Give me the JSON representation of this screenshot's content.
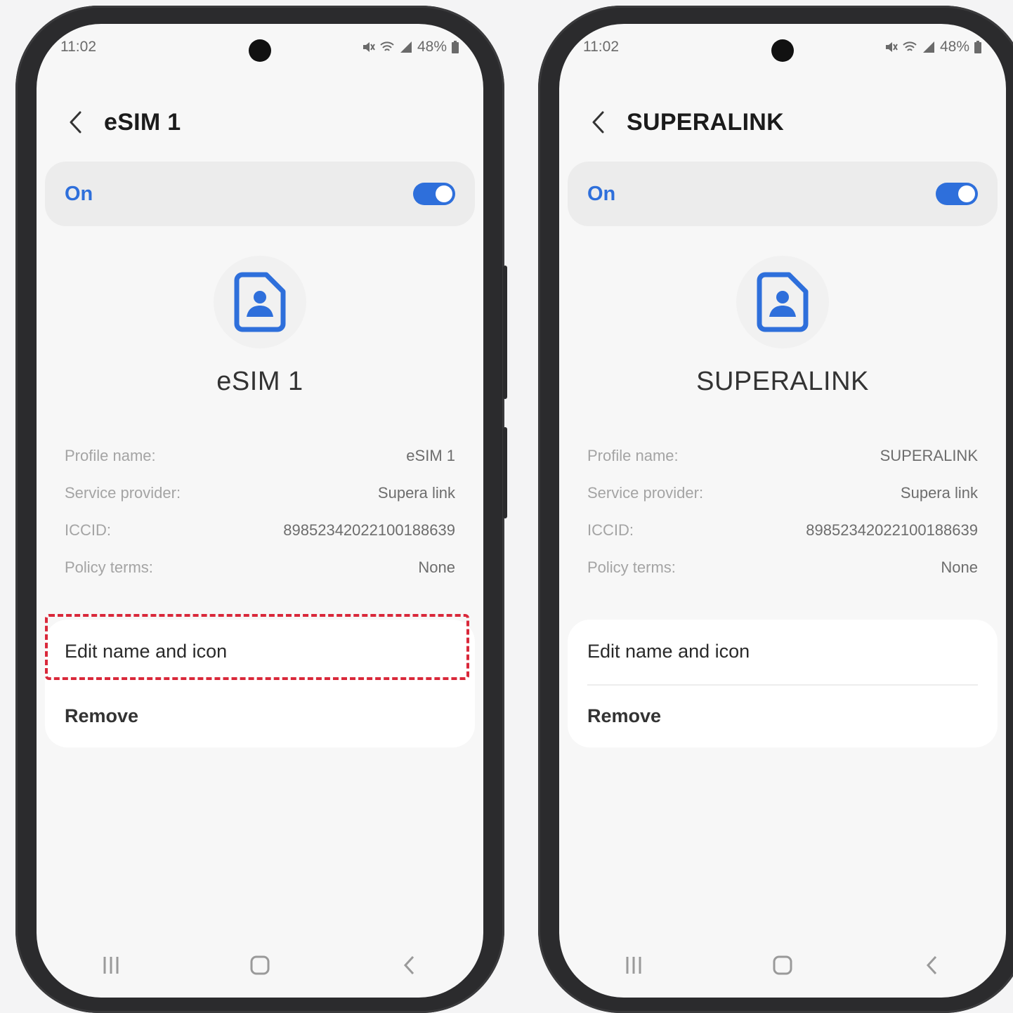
{
  "phones": [
    {
      "status": {
        "time": "11:02",
        "battery": "48%"
      },
      "title": "eSIM 1",
      "toggle_label": "On",
      "toggle_on": true,
      "profile_display_name": "eSIM 1",
      "details": [
        {
          "key": "Profile name:",
          "value": "eSIM 1"
        },
        {
          "key": "Service provider:",
          "value": "Supera link"
        },
        {
          "key": "ICCID:",
          "value": "89852342022100188639"
        },
        {
          "key": "Policy terms:",
          "value": "None"
        }
      ],
      "actions": {
        "edit": "Edit name and icon",
        "remove": "Remove"
      },
      "highlight_color": "#d9283a"
    },
    {
      "status": {
        "time": "11:02",
        "battery": "48%"
      },
      "title": "SUPERALINK",
      "toggle_label": "On",
      "toggle_on": true,
      "profile_display_name": "SUPERALINK",
      "details": [
        {
          "key": "Profile name:",
          "value": "SUPERALINK"
        },
        {
          "key": "Service provider:",
          "value": "Supera link"
        },
        {
          "key": "ICCID:",
          "value": "89852342022100188639"
        },
        {
          "key": "Policy terms:",
          "value": "None"
        }
      ],
      "actions": {
        "edit": "Edit name and icon",
        "remove": "Remove"
      }
    }
  ],
  "colors": {
    "accent": "#2e6fdb",
    "background": "#f7f7f7",
    "card": "#ececec"
  },
  "icons": [
    "back-chevron-icon",
    "sim-profile-icon",
    "mute-icon",
    "wifi-icon",
    "signal-icon",
    "battery-icon",
    "recents-icon",
    "home-icon",
    "nav-back-icon"
  ]
}
